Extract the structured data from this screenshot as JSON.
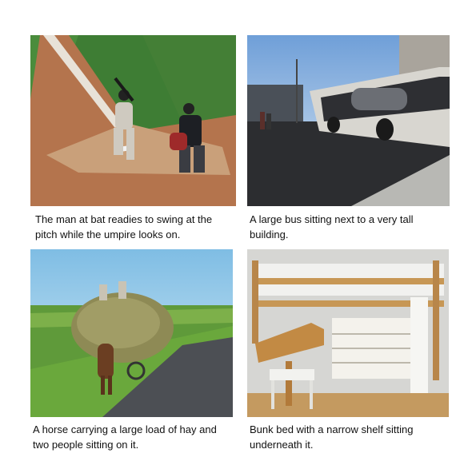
{
  "panels": [
    {
      "scene": "baseball",
      "caption_lines": [
        "The man at bat readies to swing at the",
        "pitch while the umpire looks on."
      ]
    },
    {
      "scene": "bus",
      "caption_lines": [
        "A large bus sitting next to a very tall",
        "building."
      ]
    },
    {
      "scene": "hay-cart",
      "caption_lines": [
        "A horse carrying a large load of hay and",
        "two people sitting on it."
      ]
    },
    {
      "scene": "bunk-bed",
      "caption_lines": [
        "Bunk bed with a narrow shelf sitting",
        "underneath it."
      ]
    }
  ]
}
